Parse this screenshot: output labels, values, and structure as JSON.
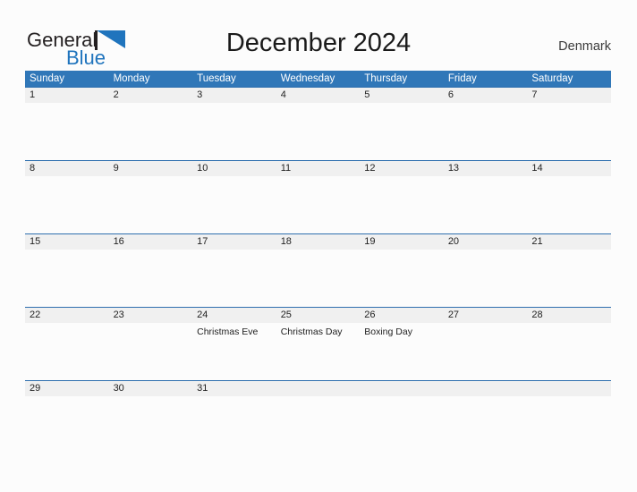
{
  "brand": {
    "name_part1": "General",
    "name_part2": "Blue",
    "accent_color": "#1f74bd",
    "text_color": "#231f20",
    "flag_icon": "blue-flag-triangle-icon"
  },
  "header": {
    "title": "December 2024",
    "country": "Denmark"
  },
  "calendar": {
    "header_bg": "#3077b8",
    "header_text_color": "#ffffff",
    "date_band_bg": "#f0f0f0",
    "rule_color": "#2e6fae",
    "weekdays": [
      "Sunday",
      "Monday",
      "Tuesday",
      "Wednesday",
      "Thursday",
      "Friday",
      "Saturday"
    ],
    "weeks": [
      {
        "days": [
          {
            "date": "1",
            "event": ""
          },
          {
            "date": "2",
            "event": ""
          },
          {
            "date": "3",
            "event": ""
          },
          {
            "date": "4",
            "event": ""
          },
          {
            "date": "5",
            "event": ""
          },
          {
            "date": "6",
            "event": ""
          },
          {
            "date": "7",
            "event": ""
          }
        ]
      },
      {
        "days": [
          {
            "date": "8",
            "event": ""
          },
          {
            "date": "9",
            "event": ""
          },
          {
            "date": "10",
            "event": ""
          },
          {
            "date": "11",
            "event": ""
          },
          {
            "date": "12",
            "event": ""
          },
          {
            "date": "13",
            "event": ""
          },
          {
            "date": "14",
            "event": ""
          }
        ]
      },
      {
        "days": [
          {
            "date": "15",
            "event": ""
          },
          {
            "date": "16",
            "event": ""
          },
          {
            "date": "17",
            "event": ""
          },
          {
            "date": "18",
            "event": ""
          },
          {
            "date": "19",
            "event": ""
          },
          {
            "date": "20",
            "event": ""
          },
          {
            "date": "21",
            "event": ""
          }
        ]
      },
      {
        "days": [
          {
            "date": "22",
            "event": ""
          },
          {
            "date": "23",
            "event": ""
          },
          {
            "date": "24",
            "event": "Christmas Eve"
          },
          {
            "date": "25",
            "event": "Christmas Day"
          },
          {
            "date": "26",
            "event": "Boxing Day"
          },
          {
            "date": "27",
            "event": ""
          },
          {
            "date": "28",
            "event": ""
          }
        ]
      },
      {
        "days": [
          {
            "date": "29",
            "event": ""
          },
          {
            "date": "30",
            "event": ""
          },
          {
            "date": "31",
            "event": ""
          },
          {
            "date": "",
            "event": ""
          },
          {
            "date": "",
            "event": ""
          },
          {
            "date": "",
            "event": ""
          },
          {
            "date": "",
            "event": ""
          }
        ]
      }
    ]
  }
}
